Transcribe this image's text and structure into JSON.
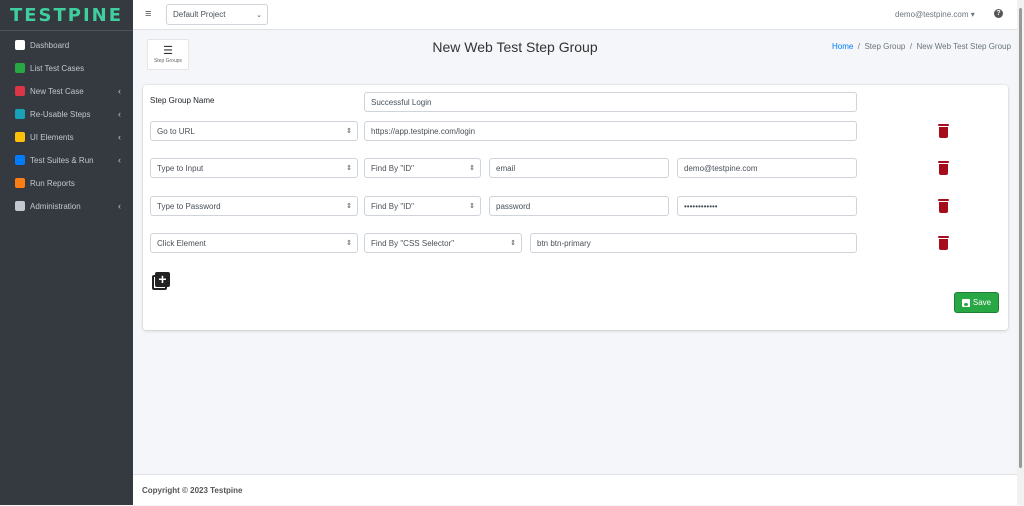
{
  "app": {
    "logo": "TESTPINE"
  },
  "sidebar": {
    "items": [
      {
        "label": "Dashboard",
        "color": "#ffffff",
        "chev": false
      },
      {
        "label": "List Test Cases",
        "color": "#28a745",
        "chev": false
      },
      {
        "label": "New Test Case",
        "color": "#dc3545",
        "chev": true
      },
      {
        "label": "Re-Usable Steps",
        "color": "#17a2b8",
        "chev": true
      },
      {
        "label": "UI Elements",
        "color": "#ffc107",
        "chev": true
      },
      {
        "label": "Test Suites & Run",
        "color": "#007bff",
        "chev": true
      },
      {
        "label": "Run Reports",
        "color": "#fd7e14",
        "chev": false
      },
      {
        "label": "Administration",
        "color": "#c2c7d0",
        "chev": true
      }
    ],
    "chevron": "‹"
  },
  "topbar": {
    "project": "Default Project",
    "user": "demo@testpine.com",
    "help": "?"
  },
  "header": {
    "step_groups_label": "Step Groups",
    "title": "New Web Test Step Group",
    "breadcrumb": [
      "Home",
      "Step Group",
      "New Web Test Step Group"
    ]
  },
  "form": {
    "name_label": "Step Group Name",
    "name_value": "Successful Login",
    "rows": [
      {
        "action": "Go to URL",
        "value": "https://app.testpine.com/login"
      },
      {
        "action": "Type to Input",
        "find": "Find By \"ID\"",
        "locator": "email",
        "value": "demo@testpine.com"
      },
      {
        "action": "Type to Password",
        "find": "Find By \"ID\"",
        "locator": "password",
        "value": "••••••••••••"
      },
      {
        "action": "Click Element",
        "find": "Find By \"CSS Selector\"",
        "locator": "btn btn-primary"
      }
    ],
    "save_label": "Save"
  },
  "footer": {
    "text": "Copyright © 2023 Testpine"
  },
  "colors": {
    "sidebar": "#343a40",
    "logo": "#3fcf9f",
    "trash": "#a50d1d",
    "save": "#28a745",
    "link": "#007bff"
  }
}
